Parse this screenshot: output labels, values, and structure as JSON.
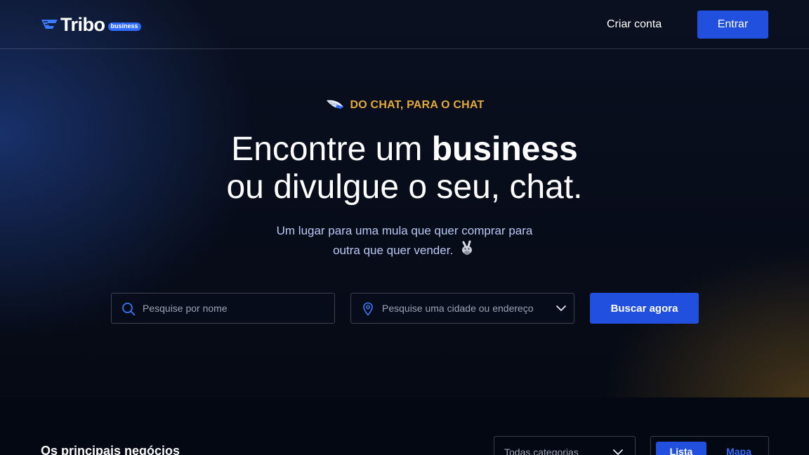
{
  "header": {
    "logo_text": "Tribo",
    "logo_badge": "business",
    "create_account": "Criar conta",
    "login": "Entrar"
  },
  "hero": {
    "eyebrow": "DO CHAT, PARA O CHAT",
    "headline_prefix": "Encontre um ",
    "headline_bold": "business",
    "headline_line2": "ou divulgue o seu, chat.",
    "subtitle_line1": "Um lugar para uma mula que quer comprar para",
    "subtitle_line2": "outra que quer vender."
  },
  "search": {
    "name_placeholder": "Pesquise por nome",
    "location_placeholder": "Pesquise uma cidade ou endereço",
    "button": "Buscar agora"
  },
  "listing": {
    "title": "Os principais negócios",
    "category_select": "Todas categorias",
    "tabs": [
      "Lista",
      "Mapa"
    ]
  },
  "colors": {
    "accent_blue": "#2150df",
    "eyebrow_gold": "#e3a93b",
    "subtitle_blue": "#b8c8f4"
  }
}
